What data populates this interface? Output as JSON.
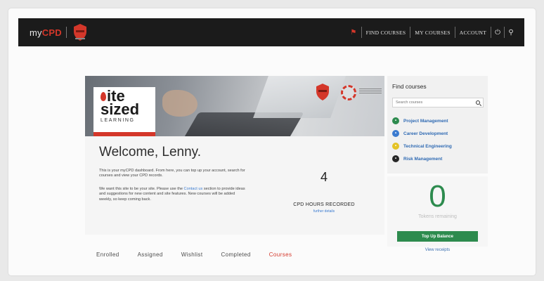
{
  "brand": {
    "prefix": "my",
    "suffix": "CPD"
  },
  "nav": {
    "home_icon": "home-icon",
    "items": [
      "FIND COURSES",
      "MY COURSES",
      "ACCOUNT"
    ],
    "extra_icons": [
      "power-icon",
      "search-icon"
    ]
  },
  "hero": {
    "line1": "ite",
    "line2": "sized",
    "line3": "LEARNING"
  },
  "welcome": {
    "title": "Welcome, Lenny.",
    "para1": "This is your myCPD dashboard. From here, you can top up your account, search for courses and view your CPD records.",
    "para2_before": "We want this site to be your site. Please use the ",
    "para2_link": "Contact us",
    "para2_after": " section to provide ideas and suggestions for new content and site features. New courses will be added weekly, so keep coming back."
  },
  "stats": {
    "hours": "4",
    "hours_label": "CPD HOURS RECORDED",
    "hours_more": "further details"
  },
  "tabs": [
    {
      "label": "Enrolled",
      "active": false
    },
    {
      "label": "Assigned",
      "active": false
    },
    {
      "label": "Wishlist",
      "active": false
    },
    {
      "label": "Completed",
      "active": false
    },
    {
      "label": "Courses",
      "active": true
    }
  ],
  "find_courses": {
    "title": "Find courses",
    "search_placeholder": "Search courses",
    "categories": [
      {
        "label": "Project Management",
        "color": "#2d8b4e",
        "icon": "leaf-icon"
      },
      {
        "label": "Career Development",
        "color": "#3b7bd0",
        "icon": "person-icon"
      },
      {
        "label": "Technical Engineering",
        "color": "#e4c326",
        "icon": "gear-icon"
      },
      {
        "label": "Risk Management",
        "color": "#262626",
        "icon": "warning-icon"
      }
    ]
  },
  "balance": {
    "value": "0",
    "label": "Tokens remaining",
    "button": "Top Up Balance",
    "receipts": "View receipts"
  },
  "colors": {
    "accent": "#d4372a",
    "green": "#2d8b4e",
    "link": "#3b7bd0",
    "topbar": "#1b1b1b"
  }
}
